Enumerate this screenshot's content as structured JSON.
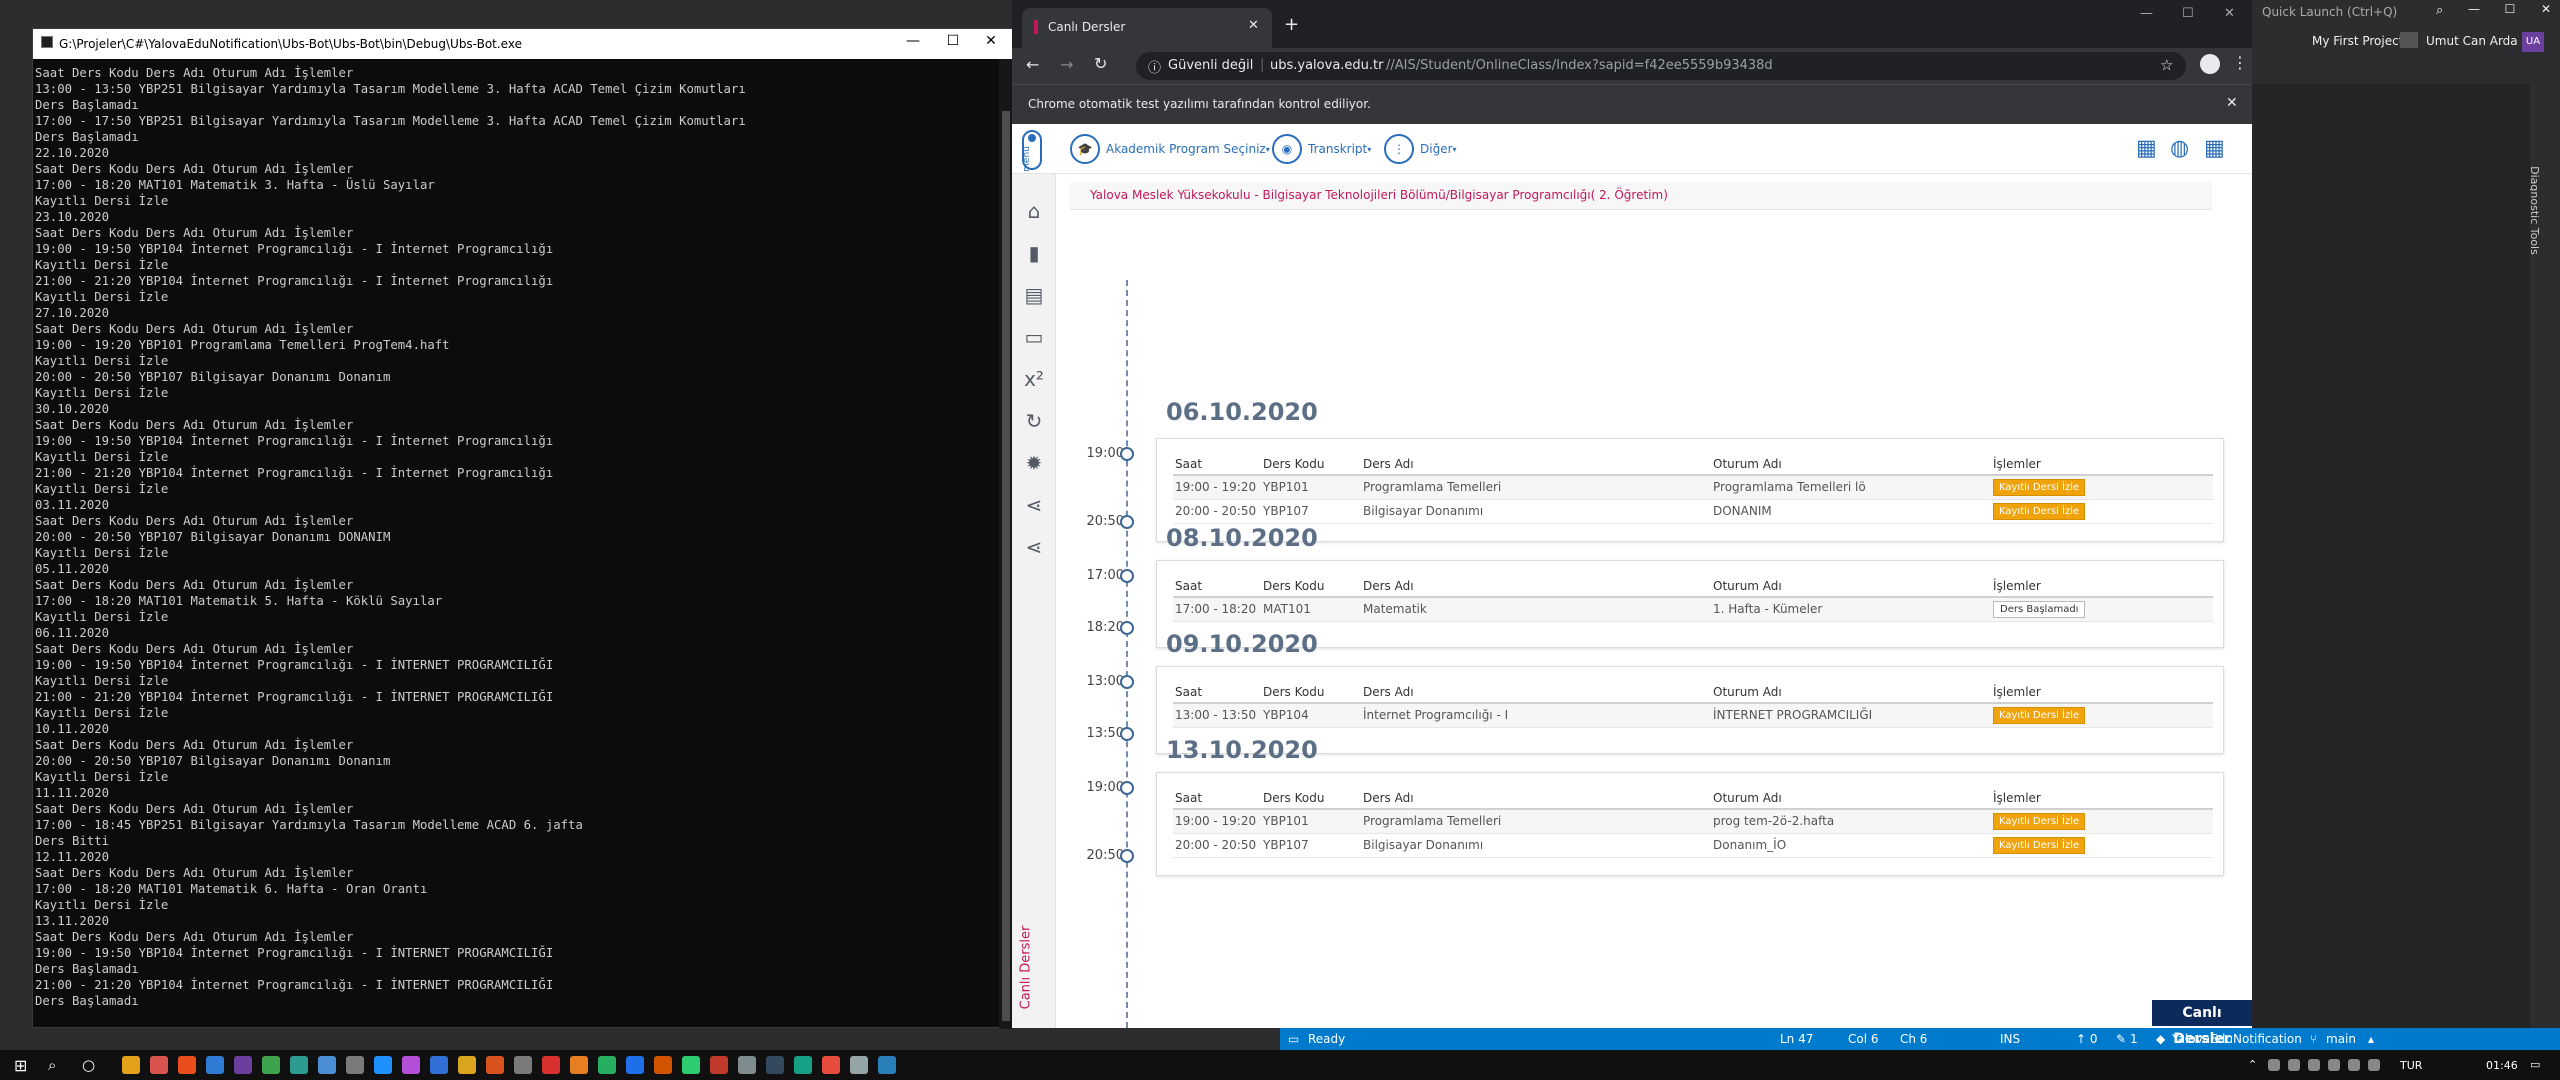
{
  "vs": {
    "quick_launch": "Quick Launch (Ctrl+Q)",
    "project": "My First Project",
    "user": "Umut Can Arda",
    "user_initials": "UA",
    "right_tools": "Diagnostic Tools",
    "status": {
      "ready": "Ready",
      "ln": "Ln 47",
      "col": "Col 6",
      "ch": "Ch 6",
      "ins": "INS",
      "up": "↑ 0",
      "pencil": "1",
      "repo": "YalovaEduNotification",
      "branch": "main"
    }
  },
  "console": {
    "title": "G:\\Projeler\\C#\\YalovaEduNotification\\Ubs-Bot\\Ubs-Bot\\bin\\Debug\\Ubs-Bot.exe",
    "lines": [
      "Saat Ders Kodu Ders Adı Oturum Adı İşlemler",
      "13:00 - 13:50 YBP251 Bilgisayar Yardımıyla Tasarım Modelleme 3. Hafta ACAD Temel Çizim Komutları",
      "Ders Başlamadı",
      "17:00 - 17:50 YBP251 Bilgisayar Yardımıyla Tasarım Modelleme 3. Hafta ACAD Temel Çizim Komutları",
      "Ders Başlamadı",
      "22.10.2020",
      "Saat Ders Kodu Ders Adı Oturum Adı İşlemler",
      "17:00 - 18:20 MAT101 Matematik 3. Hafta - Üslü Sayılar",
      "Kayıtlı Dersi İzle",
      "23.10.2020",
      "Saat Ders Kodu Ders Adı Oturum Adı İşlemler",
      "19:00 - 19:50 YBP104 İnternet Programcılığı - I İnternet Programcılığı",
      "Kayıtlı Dersi İzle",
      "21:00 - 21:20 YBP104 İnternet Programcılığı - I İnternet Programcılığı",
      "Kayıtlı Dersi İzle",
      "27.10.2020",
      "Saat Ders Kodu Ders Adı Oturum Adı İşlemler",
      "19:00 - 19:20 YBP101 Programlama Temelleri ProgTem4.haft",
      "Kayıtlı Dersi İzle",
      "20:00 - 20:50 YBP107 Bilgisayar Donanımı Donanım",
      "Kayıtlı Dersi İzle",
      "30.10.2020",
      "Saat Ders Kodu Ders Adı Oturum Adı İşlemler",
      "19:00 - 19:50 YBP104 İnternet Programcılığı - I İnternet Programcılığı",
      "Kayıtlı Dersi İzle",
      "21:00 - 21:20 YBP104 İnternet Programcılığı - I İnternet Programcılığı",
      "Kayıtlı Dersi İzle",
      "03.11.2020",
      "Saat Ders Kodu Ders Adı Oturum Adı İşlemler",
      "20:00 - 20:50 YBP107 Bilgisayar Donanımı DONANIM",
      "Kayıtlı Dersi İzle",
      "05.11.2020",
      "Saat Ders Kodu Ders Adı Oturum Adı İşlemler",
      "17:00 - 18:20 MAT101 Matematik 5. Hafta - Köklü Sayılar",
      "Kayıtlı Dersi İzle",
      "06.11.2020",
      "Saat Ders Kodu Ders Adı Oturum Adı İşlemler",
      "19:00 - 19:50 YBP104 İnternet Programcılığı - I İNTERNET PROGRAMCILIĞI",
      "Kayıtlı Dersi İzle",
      "21:00 - 21:20 YBP104 İnternet Programcılığı - I İNTERNET PROGRAMCILIĞI",
      "Kayıtlı Dersi İzle",
      "10.11.2020",
      "Saat Ders Kodu Ders Adı Oturum Adı İşlemler",
      "20:00 - 20:50 YBP107 Bilgisayar Donanımı Donanım",
      "Kayıtlı Dersi İzle",
      "11.11.2020",
      "Saat Ders Kodu Ders Adı Oturum Adı İşlemler",
      "17:00 - 18:45 YBP251 Bilgisayar Yardımıyla Tasarım Modelleme ACAD 6. jafta",
      "Ders Bitti",
      "12.11.2020",
      "Saat Ders Kodu Ders Adı Oturum Adı İşlemler",
      "17:00 - 18:20 MAT101 Matematik 6. Hafta - Oran Orantı",
      "Kayıtlı Dersi İzle",
      "13.11.2020",
      "Saat Ders Kodu Ders Adı Oturum Adı İşlemler",
      "19:00 - 19:50 YBP104 İnternet Programcılığı - I İNTERNET PROGRAMCILIĞI",
      "Ders Başlamadı",
      "21:00 - 21:20 YBP104 İnternet Programcılığı - I İNTERNET PROGRAMCILIĞI",
      "Ders Başlamadı"
    ]
  },
  "chrome": {
    "tab_title": "Canlı Dersler",
    "security": "Güvenli değil",
    "url_host": "ubs.yalova.edu.tr",
    "url_path": "//AIS/Student/OnlineClass/Index?sapid=f42ee5559b93438d",
    "infobar": "Chrome otomatik test yazılımı tarafından kontrol ediliyor."
  },
  "ubs": {
    "menu_label": "menu",
    "nav": [
      {
        "label": "Akademik Program Seçiniz"
      },
      {
        "label": "Transkript"
      },
      {
        "label": "Diğer"
      }
    ],
    "breadcrumb": "Yalova Meslek Yüksekokulu - Bilgisayar Teknolojileri Bölümü/Bilgisayar Programcılığı( 2. Öğretim)",
    "vertical_label": "Canlı Dersler",
    "badge": "Canlı Dersler",
    "headers": [
      "Saat",
      "Ders Kodu",
      "Ders Adı",
      "Oturum Adı",
      "İşlemler"
    ],
    "btn_recorded": "Kayıtlı Dersi İzle",
    "btn_not_started": "Ders Başlamadı",
    "days": [
      {
        "date": "06.10.2020",
        "start": "19:00",
        "end": "20:50",
        "rows": [
          [
            "19:00 - 19:20",
            "YBP101",
            "Programlama Temelleri",
            "Programlama Temelleri lö",
            "rec"
          ],
          [
            "20:00 - 20:50",
            "YBP107",
            "Bilgisayar Donanımı",
            "DONANIM",
            "rec"
          ]
        ]
      },
      {
        "date": "08.10.2020",
        "start": "17:00",
        "end": "18:20",
        "rows": [
          [
            "17:00 - 18:20",
            "MAT101",
            "Matematik",
            "1. Hafta - Kümeler",
            "ns"
          ]
        ]
      },
      {
        "date": "09.10.2020",
        "start": "13:00",
        "end": "13:50",
        "rows": [
          [
            "13:00 - 13:50",
            "YBP104",
            "İnternet Programcılığı - I",
            "İNTERNET PROGRAMCILIĞI",
            "rec"
          ]
        ]
      },
      {
        "date": "13.10.2020",
        "start": "19:00",
        "end": "20:50",
        "rows": [
          [
            "19:00 - 19:20",
            "YBP101",
            "Programlama Temelleri",
            "prog tem-2ö-2.hafta",
            "rec"
          ],
          [
            "20:00 - 20:50",
            "YBP107",
            "Bilgisayar Donanımı",
            "Donanım_İO",
            "rec"
          ]
        ]
      }
    ]
  },
  "taskbar": {
    "lang": "TUR",
    "time": "01:46"
  }
}
